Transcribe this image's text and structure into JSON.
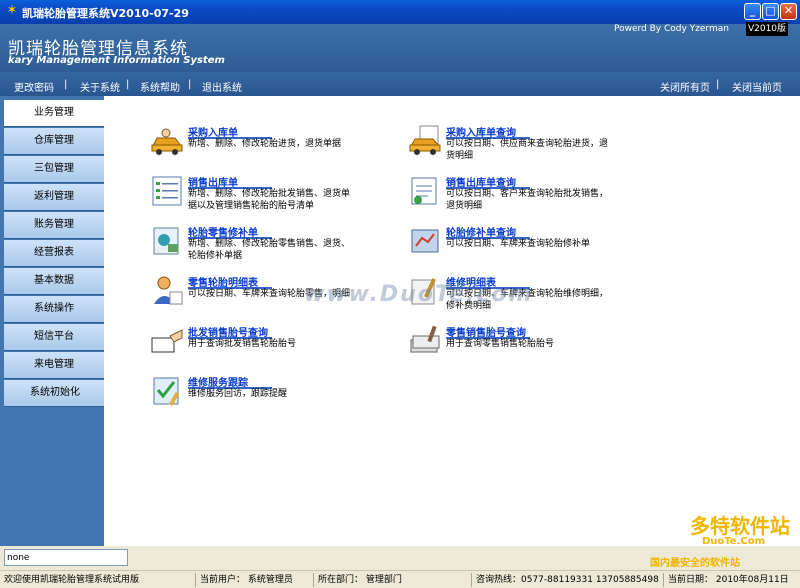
{
  "window": {
    "title": "凯瑞轮胎管理系统V2010-07-29"
  },
  "header": {
    "title": "凯瑞轮胎管理信息系统",
    "subtitle": "kary Management Information System",
    "powered_by": "Powerd By Cody Yzerman",
    "version": "V2010版"
  },
  "nav": {
    "change_password": "更改密码",
    "about": "关于系统",
    "help": "系统帮助",
    "exit": "退出系统",
    "close_all": "关闭所有页",
    "close_current": "关闭当前页",
    "sep": "|"
  },
  "sidebar": {
    "items": [
      {
        "label": "业务管理"
      },
      {
        "label": "仓库管理"
      },
      {
        "label": "三包管理"
      },
      {
        "label": "返利管理"
      },
      {
        "label": "账务管理"
      },
      {
        "label": "经营报表"
      },
      {
        "label": "基本数据"
      },
      {
        "label": "系统操作"
      },
      {
        "label": "短信平台"
      },
      {
        "label": "来电管理"
      },
      {
        "label": "系统初始化"
      }
    ]
  },
  "main": {
    "entries": [
      {
        "title": "采购入库单",
        "desc": "新增、删除、修改轮胎进货，退货单据",
        "icon": "car-icon"
      },
      {
        "title": "采购入库单查询",
        "desc": "可以按日期、供应商来查询轮胎进货，退货明细",
        "icon": "car-document-icon"
      },
      {
        "title": "销售出库单",
        "desc": "新增、删除、修改轮胎批发销售、退货单据以及管理销售轮胎的胎号清单",
        "icon": "checklist-icon"
      },
      {
        "title": "销售出库单查询",
        "desc": "可以按日期、客户来查询轮胎批发销售，退货明细",
        "icon": "notepad-icon"
      },
      {
        "title": "轮胎零售修补单",
        "desc": "新增、删除、修改轮胎零售销售、退货、轮胎修补单据",
        "icon": "invoice-icon"
      },
      {
        "title": "轮胎修补单查询",
        "desc": "可以按日期、车牌来查询轮胎修补单",
        "icon": "chart-book-icon"
      },
      {
        "title": "零售轮胎明细表",
        "desc": "可以按日期、车牌来查询轮胎零售，明细",
        "icon": "user-write-icon"
      },
      {
        "title": "维修明细表",
        "desc": "可以按日期、车牌来查询轮胎维修明细，修补费明细",
        "icon": "paper-pen-icon"
      },
      {
        "title": "批发销售胎号查询",
        "desc": "用于查询批发销售轮胎胎号",
        "icon": "hand-card-icon"
      },
      {
        "title": "零售销售胎号查询",
        "desc": "用于查询零售销售轮胎胎号",
        "icon": "papers-stack-icon"
      },
      {
        "title": "维修服务跟踪",
        "desc": "维修服务回访，跟踪提醒",
        "icon": "check-pencil-icon"
      }
    ],
    "watermark": "www.DuoTe.com"
  },
  "bottom": {
    "input_value": "none"
  },
  "status": {
    "welcome": "欢迎使用凯瑞轮胎管理系统试用版",
    "user": "当前用户：  系统管理员",
    "dept": "所在部门：  管理部门",
    "hotline": "咨询热线：0577-88119331  13705885498",
    "date": "当前日期：  2010年08月11日"
  },
  "logo_watermark": {
    "big": "多特软件站",
    "url": "DuoTe.Com",
    "small": "国内最安全的软件站"
  }
}
